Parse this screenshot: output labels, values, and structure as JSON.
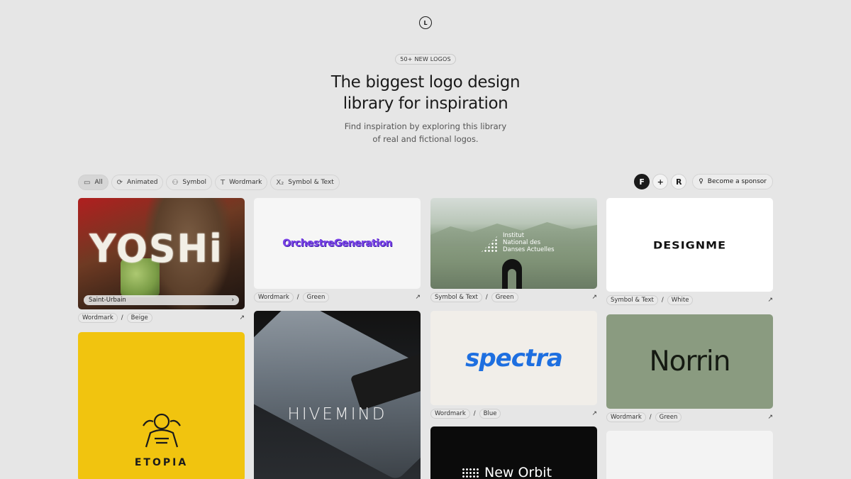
{
  "brand": {
    "mark": "L"
  },
  "hero": {
    "badge": "50+ NEW LOGOS",
    "title_line1": "The biggest logo design",
    "title_line2": "library for inspiration",
    "subtitle_line1": "Find inspiration by exploring this library",
    "subtitle_line2": "of real and fictional logos."
  },
  "filters": [
    {
      "label": "All",
      "icon": "folder-icon",
      "active": true
    },
    {
      "label": "Animated",
      "icon": "refresh-icon",
      "active": false
    },
    {
      "label": "Symbol",
      "icon": "shapes-icon",
      "active": false
    },
    {
      "label": "Wordmark",
      "icon": "type-icon",
      "active": false
    },
    {
      "label": "Symbol & Text",
      "icon": "subscript-icon",
      "active": false
    }
  ],
  "tools": {
    "framer": "F",
    "figma": "+",
    "icon3": "R",
    "sponsor_label": "Become a sponsor"
  },
  "cards": {
    "yoshi": {
      "wordmark": "YOSHi",
      "caption": "Saint-Urbain",
      "type": "Wordmark",
      "color": "Beige"
    },
    "etopia": {
      "wordmark": "ETOPIA"
    },
    "orchestre": {
      "wordmark": "OrchestreGeneration",
      "type": "Wordmark",
      "color": "Green"
    },
    "hivemind": {
      "wordmark": "HIVEMIND"
    },
    "institut": {
      "line1": "Institut",
      "line2": "National des",
      "line3": "Danses Actuelles",
      "type": "Symbol & Text",
      "color": "Green"
    },
    "spectra": {
      "wordmark": "spectra",
      "type": "Wordmark",
      "color": "Blue"
    },
    "neworbit": {
      "wordmark": "New Orbit"
    },
    "designme": {
      "wordmark": "DESIGNME",
      "type": "Symbol & Text",
      "color": "White"
    },
    "norrin": {
      "wordmark": "Norrin",
      "type": "Wordmark",
      "color": "Green"
    }
  },
  "colors": {
    "background": "#e6e6e6",
    "yellow": "#f1c40f",
    "sage": "#8a9b80",
    "blue": "#1e6fe0",
    "purple": "#7a42e8"
  }
}
